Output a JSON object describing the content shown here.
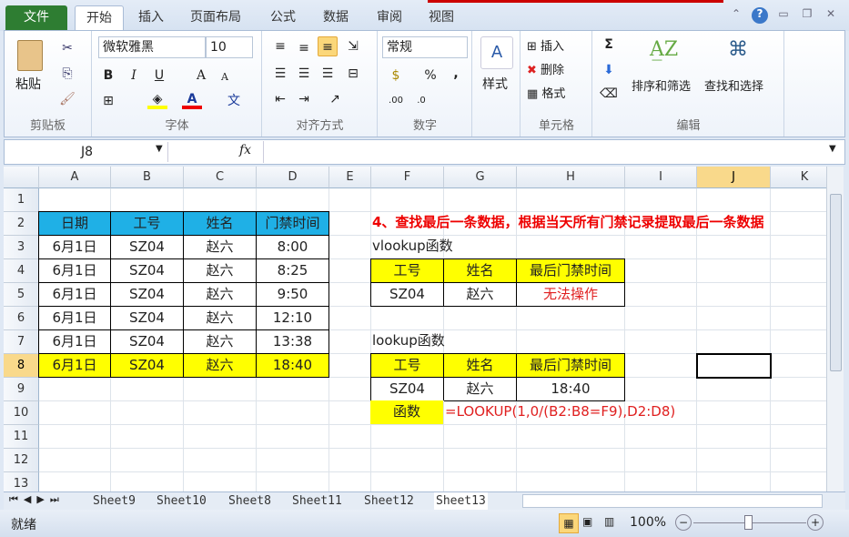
{
  "ribbon_tabs": [
    "文件",
    "开始",
    "插入",
    "页面布局",
    "公式",
    "数据",
    "审阅",
    "视图"
  ],
  "active_tab": "开始",
  "clipboard": {
    "paste": "粘贴",
    "group": "剪贴板"
  },
  "font": {
    "name": "微软雅黑",
    "size": "10",
    "bold": "B",
    "italic": "I",
    "underline": "U",
    "grow": "A",
    "shrink": "A",
    "color_letter": "A",
    "phonetic": "文",
    "group": "字体",
    "highlight_color": "#ffff00",
    "font_color": "#e00000"
  },
  "alignment": {
    "group": "对齐方式"
  },
  "number": {
    "format": "常规",
    "percent": "%",
    "comma": ",",
    "inc": ".00",
    "dec": ".0",
    "group": "数字"
  },
  "styles": {
    "label": "样式"
  },
  "cells_group": {
    "insert": "插入",
    "delete": "删除",
    "format": "格式",
    "group": "单元格"
  },
  "editing": {
    "sum": "Σ",
    "sort": "排序和筛选",
    "find": "查找和选择",
    "group": "编辑"
  },
  "formula_bar": {
    "name_box": "J8",
    "fx": "fx",
    "value": ""
  },
  "columns": [
    "A",
    "B",
    "C",
    "D",
    "E",
    "F",
    "G",
    "H",
    "I",
    "J",
    "K"
  ],
  "selected": {
    "col": "J",
    "row": 8
  },
  "rows": [
    1,
    2,
    3,
    4,
    5,
    6,
    7,
    8,
    9,
    10,
    11,
    12,
    13
  ],
  "cells": [
    {
      "c": "A",
      "r": 2,
      "t": "日期",
      "s": "blue b"
    },
    {
      "c": "B",
      "r": 2,
      "t": "工号",
      "s": "blue b"
    },
    {
      "c": "C",
      "r": 2,
      "t": "姓名",
      "s": "blue b"
    },
    {
      "c": "D",
      "r": 2,
      "t": "门禁时间",
      "s": "blue b"
    },
    {
      "c": "A",
      "r": 3,
      "t": "6月1日",
      "s": "b"
    },
    {
      "c": "B",
      "r": 3,
      "t": "SZ04",
      "s": "b"
    },
    {
      "c": "C",
      "r": 3,
      "t": "赵六",
      "s": "b"
    },
    {
      "c": "D",
      "r": 3,
      "t": "8:00",
      "s": "b"
    },
    {
      "c": "A",
      "r": 4,
      "t": "6月1日",
      "s": "b"
    },
    {
      "c": "B",
      "r": 4,
      "t": "SZ04",
      "s": "b"
    },
    {
      "c": "C",
      "r": 4,
      "t": "赵六",
      "s": "b"
    },
    {
      "c": "D",
      "r": 4,
      "t": "8:25",
      "s": "b"
    },
    {
      "c": "A",
      "r": 5,
      "t": "6月1日",
      "s": "b"
    },
    {
      "c": "B",
      "r": 5,
      "t": "SZ04",
      "s": "b"
    },
    {
      "c": "C",
      "r": 5,
      "t": "赵六",
      "s": "b"
    },
    {
      "c": "D",
      "r": 5,
      "t": "9:50",
      "s": "b"
    },
    {
      "c": "A",
      "r": 6,
      "t": "6月1日",
      "s": "b"
    },
    {
      "c": "B",
      "r": 6,
      "t": "SZ04",
      "s": "b"
    },
    {
      "c": "C",
      "r": 6,
      "t": "赵六",
      "s": "b"
    },
    {
      "c": "D",
      "r": 6,
      "t": "12:10",
      "s": "b"
    },
    {
      "c": "A",
      "r": 7,
      "t": "6月1日",
      "s": "b"
    },
    {
      "c": "B",
      "r": 7,
      "t": "SZ04",
      "s": "b"
    },
    {
      "c": "C",
      "r": 7,
      "t": "赵六",
      "s": "b"
    },
    {
      "c": "D",
      "r": 7,
      "t": "13:38",
      "s": "b"
    },
    {
      "c": "A",
      "r": 8,
      "t": "6月1日",
      "s": "b yel"
    },
    {
      "c": "B",
      "r": 8,
      "t": "SZ04",
      "s": "b yel"
    },
    {
      "c": "C",
      "r": 8,
      "t": "赵六",
      "s": "b yel"
    },
    {
      "c": "D",
      "r": 8,
      "t": "18:40",
      "s": "b yel"
    },
    {
      "c": "F",
      "r": 2,
      "t": "4、查找最后一条数据，根据当天所有门禁记录提取最后一条数据",
      "s": "left title"
    },
    {
      "c": "F",
      "r": 3,
      "t": "vlookup函数",
      "s": "left"
    },
    {
      "c": "F",
      "r": 4,
      "t": "工号",
      "s": "b yel"
    },
    {
      "c": "G",
      "r": 4,
      "t": "姓名",
      "s": "b yel"
    },
    {
      "c": "H",
      "r": 4,
      "t": "最后门禁时间",
      "s": "b yel"
    },
    {
      "c": "F",
      "r": 5,
      "t": "SZ04",
      "s": "b"
    },
    {
      "c": "G",
      "r": 5,
      "t": "赵六",
      "s": "b"
    },
    {
      "c": "H",
      "r": 5,
      "t": "无法操作",
      "s": "b red"
    },
    {
      "c": "F",
      "r": 7,
      "t": "lookup函数",
      "s": "left"
    },
    {
      "c": "F",
      "r": 8,
      "t": "工号",
      "s": "b yel"
    },
    {
      "c": "G",
      "r": 8,
      "t": "姓名",
      "s": "b yel"
    },
    {
      "c": "H",
      "r": 8,
      "t": "最后门禁时间",
      "s": "b yel"
    },
    {
      "c": "F",
      "r": 9,
      "t": "SZ04",
      "s": "b"
    },
    {
      "c": "G",
      "r": 9,
      "t": "赵六",
      "s": "b"
    },
    {
      "c": "H",
      "r": 9,
      "t": "18:40",
      "s": "b"
    },
    {
      "c": "F",
      "r": 10,
      "t": "函数",
      "s": "yel"
    },
    {
      "c": "G",
      "r": 10,
      "t": "=LOOKUP(1,0/(B2:B8=F9),D2:D8)",
      "s": "left red"
    }
  ],
  "sheets": [
    "Sheet9",
    "Sheet10",
    "Sheet8",
    "Sheet11",
    "Sheet12",
    "Sheet13"
  ],
  "active_sheet": "Sheet13",
  "status": {
    "ready": "就绪",
    "zoom": "100%"
  }
}
